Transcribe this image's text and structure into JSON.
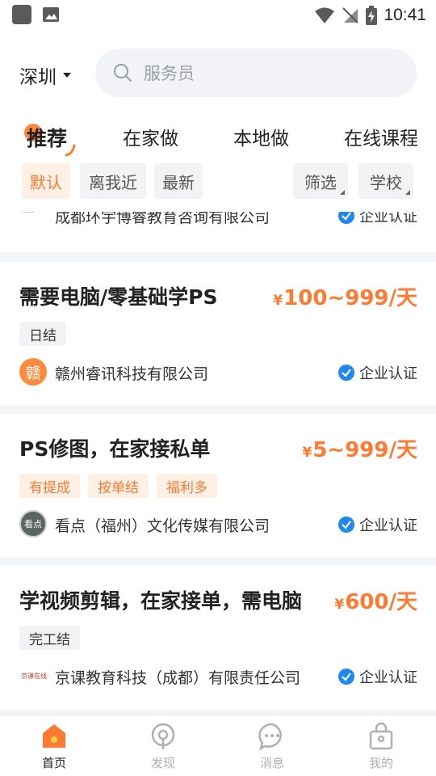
{
  "status_bar": {
    "time": "10:41"
  },
  "header": {
    "city": "深圳",
    "search_placeholder": "服务员"
  },
  "tabs": [
    {
      "label": "推荐",
      "active": true
    },
    {
      "label": "在家做",
      "active": false
    },
    {
      "label": "本地做",
      "active": false
    },
    {
      "label": "在线课程",
      "active": false
    }
  ],
  "filters": {
    "default": "默认",
    "nearby": "离我近",
    "newest": "最新",
    "filter": "筛选",
    "school": "学校"
  },
  "prev_card": {
    "company": "成都环宇博睿教育咨询有限公司",
    "verified": "企业认证"
  },
  "jobs": [
    {
      "title": "需要电脑/零基础学PS",
      "currency": "¥",
      "salary": "100~999/天",
      "tags": [
        "日结"
      ],
      "logo_text": "赣",
      "company": "赣州睿讯科技有限公司",
      "verified": "企业认证"
    },
    {
      "title": "PS修图，在家接私单",
      "currency": "¥",
      "salary": "5~999/天",
      "tags": [
        "有提成",
        "按单结",
        "福利多"
      ],
      "logo_text": "看点",
      "company": "看点（福州）文化传媒有限公司",
      "verified": "企业认证"
    },
    {
      "title": "学视频剪辑，在家接单，需电脑",
      "currency": "¥",
      "salary": "600/天",
      "tags": [
        "完工结"
      ],
      "logo_text": "京课在线",
      "company": "京课教育科技（成都）有限责任公司",
      "verified": "企业认证"
    }
  ],
  "nav": {
    "home": "首页",
    "discover": "发现",
    "messages": "消息",
    "mine": "我的"
  },
  "colors": {
    "accent": "#ff7a30",
    "verified_blue": "#1e88f0"
  }
}
